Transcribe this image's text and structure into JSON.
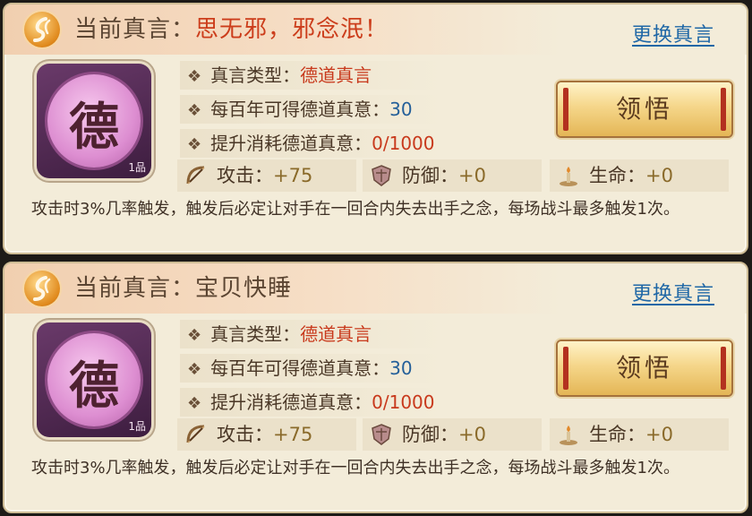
{
  "panels": [
    {
      "title_prefix": "当前真言：",
      "title_name": "思无邪，邪念泯！",
      "switch_label": "更换真言",
      "icon_glyph": "德",
      "icon_grade": "1品",
      "type_label": "真言类型：",
      "type_value": "德道真言",
      "gain_label": "每百年可得德道真意：",
      "gain_value": "30",
      "cost_label": "提升消耗德道真意：",
      "cost_value": "0/1000",
      "attack_label": "攻击：",
      "attack_value": "+75",
      "defense_label": "防御：",
      "defense_value": "+0",
      "life_label": "生命：",
      "life_value": "+0",
      "learn_label": "领悟",
      "description": "攻击时3%几率触发，触发后必定让对手在一回合内失去出手之念，每场战斗最多触发1次。"
    },
    {
      "title_prefix": "当前真言：",
      "title_name": "宝贝快睡",
      "switch_label": "更换真言",
      "icon_glyph": "德",
      "icon_grade": "1品",
      "type_label": "真言类型：",
      "type_value": "德道真言",
      "gain_label": "每百年可得德道真意：",
      "gain_value": "30",
      "cost_label": "提升消耗德道真意：",
      "cost_value": "0/1000",
      "attack_label": "攻击：",
      "attack_value": "+75",
      "defense_label": "防御：",
      "defense_value": "+0",
      "life_label": "生命：",
      "life_value": "+0",
      "learn_label": "领悟",
      "description": "攻击时3%几率触发，触发后必定让对手在一回合内失去出手之念，每场战斗最多触发1次。"
    }
  ],
  "icons": {
    "title": "swirl-icon",
    "bullet": "diamond-bullet-icon",
    "attack": "bow-icon",
    "defense": "shield-icon",
    "life": "candle-icon"
  },
  "colors": {
    "highlight_red": "#cc3d1b",
    "link_blue": "#1f67a6",
    "panel_bg": "#f3ecd9"
  }
}
